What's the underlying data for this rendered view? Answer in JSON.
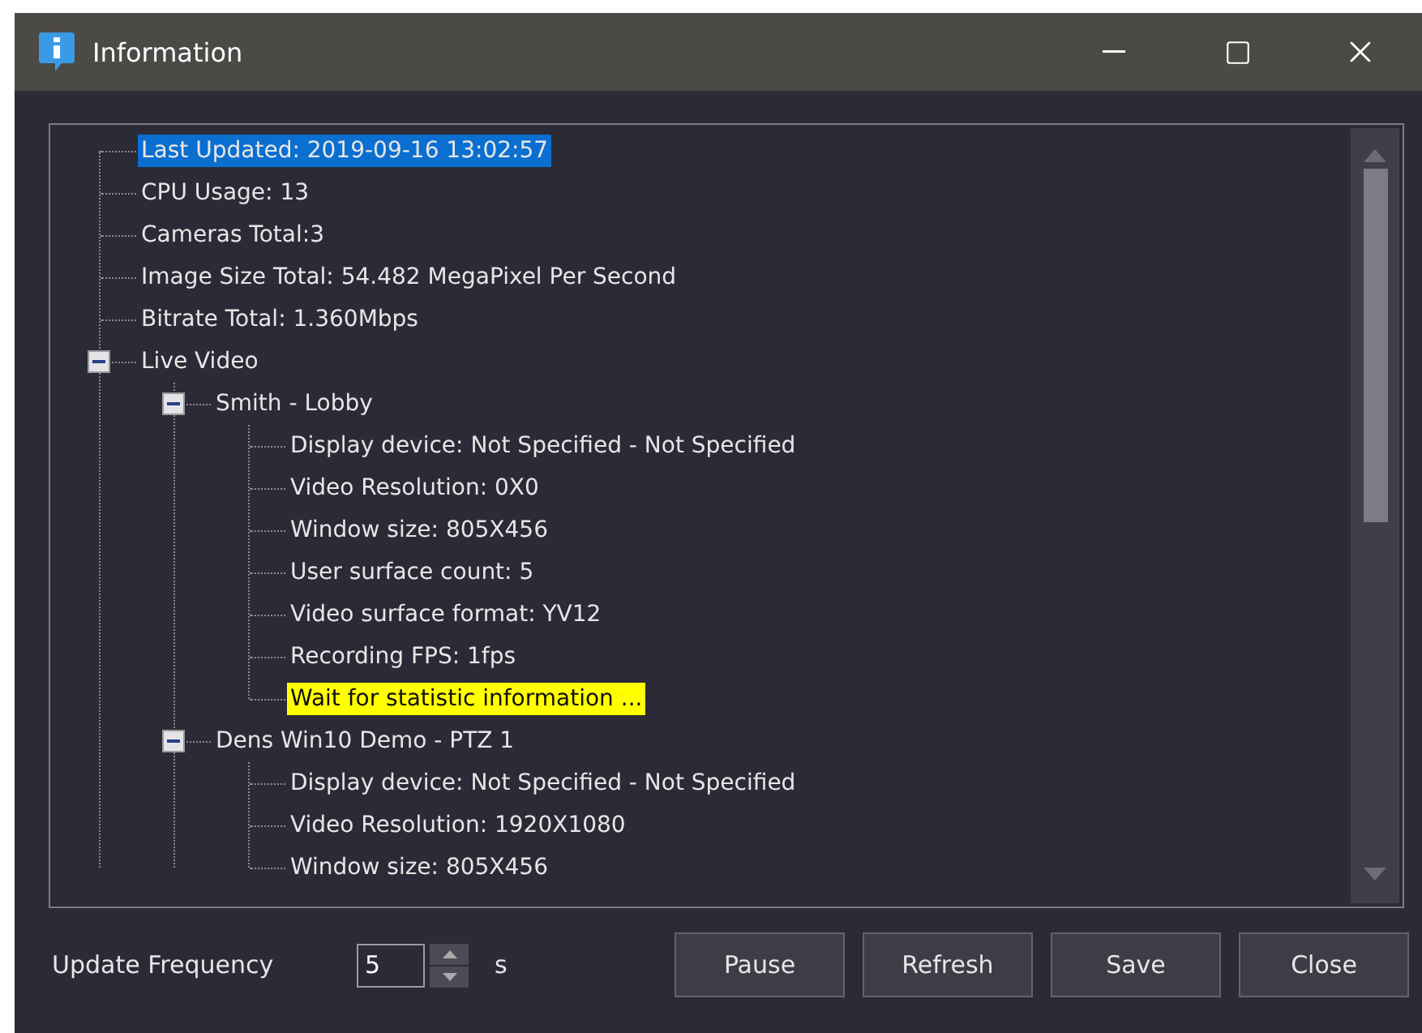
{
  "window": {
    "title": "Information"
  },
  "tree": [
    {
      "label": "Last Updated: 2019-09-16 13:02:57",
      "kind": "item",
      "selected": true
    },
    {
      "label": "CPU Usage: 13",
      "kind": "item",
      "selected": false
    },
    {
      "label": "Cameras Total:3",
      "kind": "item",
      "selected": false
    },
    {
      "label": "Image Size Total: 54.482 MegaPixel Per Second",
      "kind": "item",
      "selected": false
    },
    {
      "label": "Bitrate Total: 1.360Mbps",
      "kind": "item",
      "selected": false
    },
    {
      "label": "Live Video",
      "kind": "item",
      "selected": false,
      "expanded": true,
      "children": [
        {
          "label": "Smith - Lobby",
          "kind": "item",
          "selected": false,
          "expanded": true,
          "children": [
            {
              "label": "Display device: Not Specified - Not Specified",
              "kind": "item",
              "selected": false
            },
            {
              "label": "Video Resolution: 0X0",
              "kind": "item",
              "selected": false
            },
            {
              "label": "Window size: 805X456",
              "kind": "item",
              "selected": false
            },
            {
              "label": "User surface count: 5",
              "kind": "item",
              "selected": false
            },
            {
              "label": "Video surface format: YV12",
              "kind": "item",
              "selected": false
            },
            {
              "label": "Recording FPS: 1fps",
              "kind": "item",
              "selected": false
            },
            {
              "label": "Wait for statistic information ...",
              "kind": "notice",
              "selected": false
            }
          ]
        },
        {
          "label": "Dens Win10 Demo - PTZ 1",
          "kind": "item",
          "selected": false,
          "expanded": true,
          "children": [
            {
              "label": "Display device: Not Specified - Not Specified",
              "kind": "item",
              "selected": false
            },
            {
              "label": "Video Resolution: 1920X1080",
              "kind": "item",
              "selected": false
            },
            {
              "label": "Window size: 805X456",
              "kind": "item",
              "selected": false
            }
          ]
        }
      ]
    }
  ],
  "update_frequency": {
    "label": "Update Frequency",
    "value": "5",
    "unit": "s"
  },
  "buttons": [
    "Pause",
    "Refresh",
    "Save",
    "Close"
  ]
}
